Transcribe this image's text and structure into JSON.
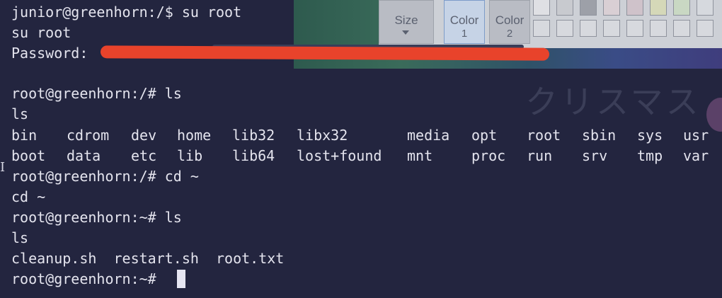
{
  "background_app": {
    "size_label": "Size",
    "color1_label": "Color",
    "color1_num": "1",
    "color2_label": "Color",
    "color2_num": "2",
    "kana_text": "クリスマス",
    "swatch_colors": [
      "#dfe0e4",
      "#c8cacf",
      "#9da0a8",
      "#d9cfd4",
      "#cfc2ca",
      "#d5d8b8",
      "#c9d8c3",
      "#d6d9de"
    ]
  },
  "terminal": {
    "lines": [
      "junior@greenhorn:/$ su root",
      "su root",
      "Password:",
      "",
      "root@greenhorn:/# ls",
      "ls",
      "",
      "",
      "root@greenhorn:/# cd ~",
      "cd ~",
      "root@greenhorn:~# ls",
      "ls",
      "cleanup.sh  restart.sh  root.txt",
      "root@greenhorn:~# "
    ],
    "ls_root_row1": [
      "bin",
      "cdrom",
      "dev",
      "home",
      "lib32",
      "libx32",
      "media",
      "opt",
      "root",
      "sbin",
      "sys",
      "usr"
    ],
    "ls_root_row2": [
      "boot",
      "data",
      "etc",
      "lib",
      "lib64",
      "lost+found",
      "mnt",
      "proc",
      "run",
      "srv",
      "tmp",
      "var"
    ],
    "colors": {
      "text": "#e4e4ee",
      "background": "#23253f",
      "redaction": "#e8432b"
    }
  }
}
